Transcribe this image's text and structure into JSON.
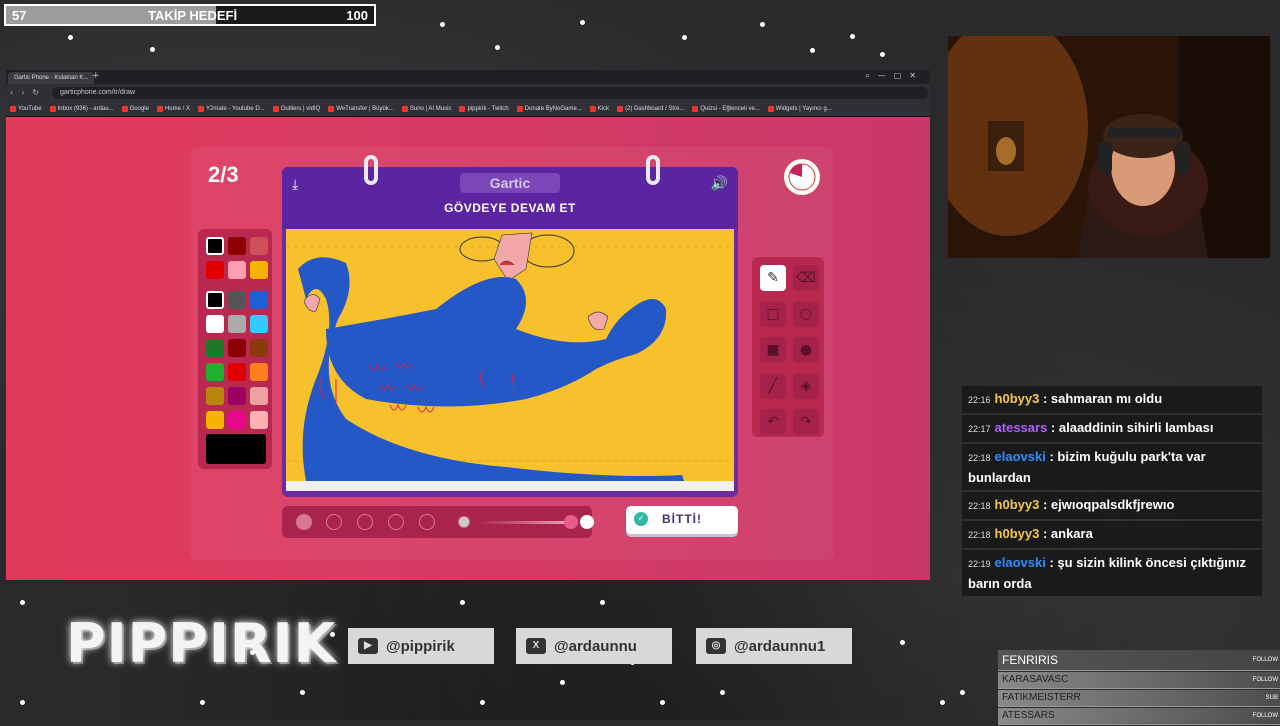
{
  "goal": {
    "current": "57",
    "label": "TAKİP HEDEFİ",
    "target": "100",
    "progress": 0.57
  },
  "browser": {
    "tab_title": "Gartic Phone - Kulaktan K...",
    "url": "garticphone.com/tr/draw",
    "bookmarks": [
      "YouTube",
      "Inbox (936) - ardau...",
      "Google",
      "Home / X",
      "Y2mate - Youtube D...",
      "Outliers | vidIQ",
      "WeTransfer | Büyük...",
      "Suno | AI Music",
      "pippirik - Twitch",
      "Donate ByNoGame...",
      "Kick",
      "(2) Dashboard / Stre...",
      "Quizsi - Eğlenceli ve...",
      "Widgets | Yayıncı g..."
    ]
  },
  "game": {
    "round": "2/3",
    "logo": "Gartic",
    "instruction": "GÖVDEYE DEVAM ET",
    "done_label": "BİTTİ!",
    "palette": [
      "#000000",
      "#8b0000",
      "#d0505a",
      "#e00000",
      "#ff9fb0",
      "#f5b300",
      "#000000",
      "#555555",
      "#1f5fd8",
      "#ffffff",
      "#aaaaaa",
      "#33c8ff",
      "#1a7a2a",
      "#8b0000",
      "#8b3a10",
      "#20b030",
      "#e00000",
      "#ff7f20",
      "#b8860b",
      "#9c0060",
      "#f0a0a0",
      "#f5b300",
      "#e60a8a",
      "#ffb0b0"
    ],
    "current_color": "#000000",
    "tools": [
      "pencil-icon",
      "eraser-icon",
      "square-outline-icon",
      "circle-outline-icon",
      "square-filled-icon",
      "circle-filled-icon",
      "line-icon",
      "fill-bucket-icon",
      "undo-icon",
      "redo-icon"
    ]
  },
  "chat": [
    {
      "time": "22:16",
      "user": "h0byy3",
      "color": "#f2c84b",
      "text": "sahmaran mı oldu"
    },
    {
      "time": "22:17",
      "user": "atessars",
      "color": "#b05cff",
      "text": "alaaddinin sihirli lambası"
    },
    {
      "time": "22:18",
      "user": "elaovski",
      "color": "#2b8fff",
      "text": "bizim kuğulu park'ta var bunlardan"
    },
    {
      "time": "22:18",
      "user": "h0byy3",
      "color": "#f2c84b",
      "text": "ejwıoqpalsdkfjrewıo"
    },
    {
      "time": "22:18",
      "user": "h0byy3",
      "color": "#f2c84b",
      "text": "ankara"
    },
    {
      "time": "22:19",
      "user": "elaovski",
      "color": "#2b8fff",
      "text": "şu sizin kilink öncesi çıktığınız barın orda"
    }
  ],
  "streamer_name": "PIPPIRIK",
  "socials": [
    {
      "icon": "youtube-icon",
      "handle": "@pippirik"
    },
    {
      "icon": "x-icon",
      "handle": "@ardaunnu"
    },
    {
      "icon": "instagram-icon",
      "handle": "@ardaunnu1"
    }
  ],
  "events": [
    {
      "name": "FENRIRIS",
      "type": "FOLLOW"
    },
    {
      "name": "KARASAVASC",
      "type": "FOLLOW"
    },
    {
      "name": "FATIKMEISTERR",
      "type": "SUB"
    },
    {
      "name": "ATESSARS",
      "type": "FOLLOW"
    }
  ]
}
